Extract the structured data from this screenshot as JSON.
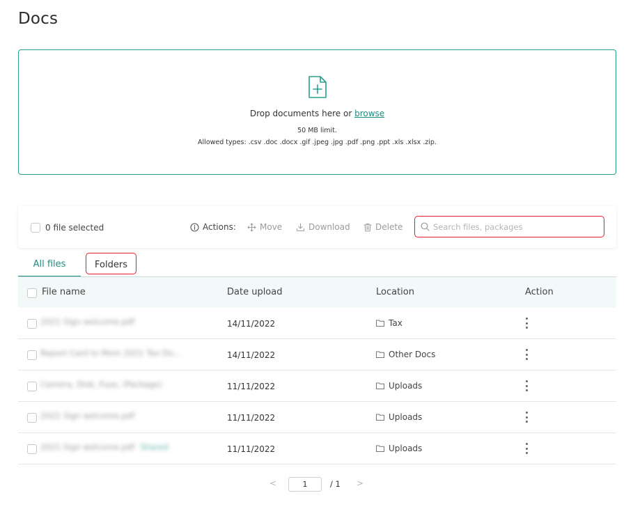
{
  "page": {
    "title": "Docs"
  },
  "dropzone": {
    "prompt": "Drop documents here or ",
    "browse_link": "browse",
    "limit": "50 MB limit.",
    "allowed_types": "Allowed types: .csv .doc .docx .gif .jpeg .jpg .pdf .png .ppt .xls .xlsx .zip."
  },
  "toolbar": {
    "selected_label": "0 file selected",
    "actions_label": "Actions:",
    "move_label": "Move",
    "download_label": "Download",
    "delete_label": "Delete",
    "search_placeholder": "Search files, packages"
  },
  "tabs": [
    {
      "label": "All files",
      "active": true
    },
    {
      "label": "Folders",
      "active": false
    }
  ],
  "table": {
    "headers": {
      "file_name": "File name",
      "date_upload": "Date upload",
      "location": "Location",
      "action": "Action"
    },
    "rows": [
      {
        "file_name": "2021 Sign welcome.pdf",
        "date": "14/11/2022",
        "location": "Tax"
      },
      {
        "file_name": "Report Card to Mom 2021 Tax Do...",
        "date": "14/11/2022",
        "location": "Other Docs"
      },
      {
        "file_name": "Camera, Disk, Fuse, (Package)",
        "date": "11/11/2022",
        "location": "Uploads"
      },
      {
        "file_name": "2021 Sign welcome.pdf",
        "date": "11/11/2022",
        "location": "Uploads"
      },
      {
        "file_name": "2021 Sign welcome.pdf",
        "badge": "Shared",
        "date": "11/11/2022",
        "location": "Uploads"
      }
    ]
  },
  "pager": {
    "prev": "<",
    "current": "1",
    "total": "/ 1",
    "next": ">"
  },
  "colors": {
    "accent": "#1f8c80",
    "highlight": "#e0202a",
    "header_bg": "#f3f8f8"
  }
}
